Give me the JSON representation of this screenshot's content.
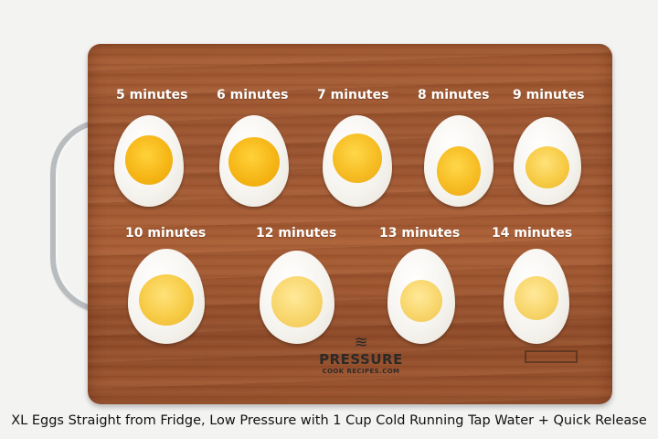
{
  "labels": {
    "t5": "5 minutes",
    "t6": "6 minutes",
    "t7": "7 minutes",
    "t8": "8 minutes",
    "t9": "9 minutes",
    "t10": "10 minutes",
    "t12": "12 minutes",
    "t13": "13 minutes",
    "t14": "14 minutes"
  },
  "logo": {
    "name": "PRESSURE",
    "sub": "COOK RECIPES.COM",
    "mark": "≋"
  },
  "caption": "XL Eggs Straight from Fridge, Low Pressure with 1 Cup Cold Running Tap Water + Quick Release",
  "colors": {
    "board": "#9e5630",
    "egg_white": "#f6f4ef",
    "yolk_liquid": "#f5b414",
    "yolk_firm": "#f8d66c"
  }
}
